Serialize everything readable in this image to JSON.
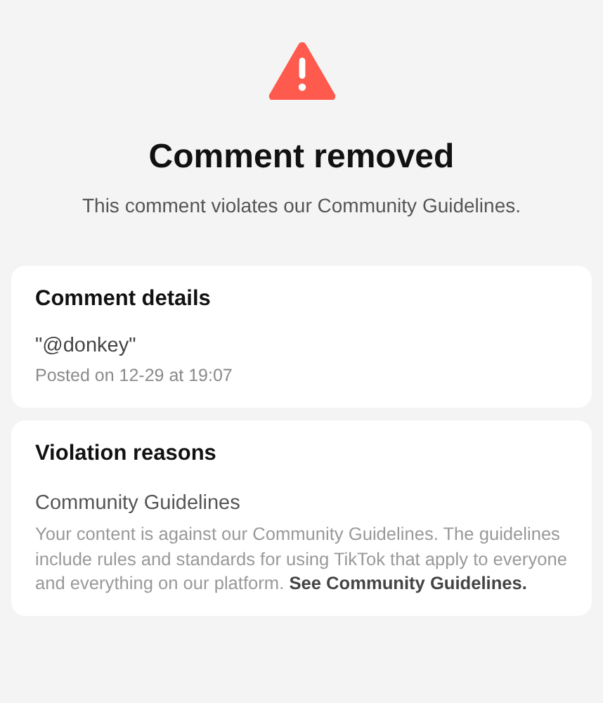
{
  "header": {
    "title": "Comment removed",
    "subtitle": "This comment violates our Community Guidelines."
  },
  "comment_details": {
    "heading": "Comment details",
    "comment": "\"@donkey\"",
    "posted": "Posted on 12-29 at 19:07"
  },
  "violation_reasons": {
    "heading": "Violation reasons",
    "reason": "Community Guidelines",
    "description": "Your content is against our Community Guidelines. The guidelines include rules and standards for using TikTok that apply to everyone and everything on our platform.",
    "link": "See Community Guidelines."
  }
}
